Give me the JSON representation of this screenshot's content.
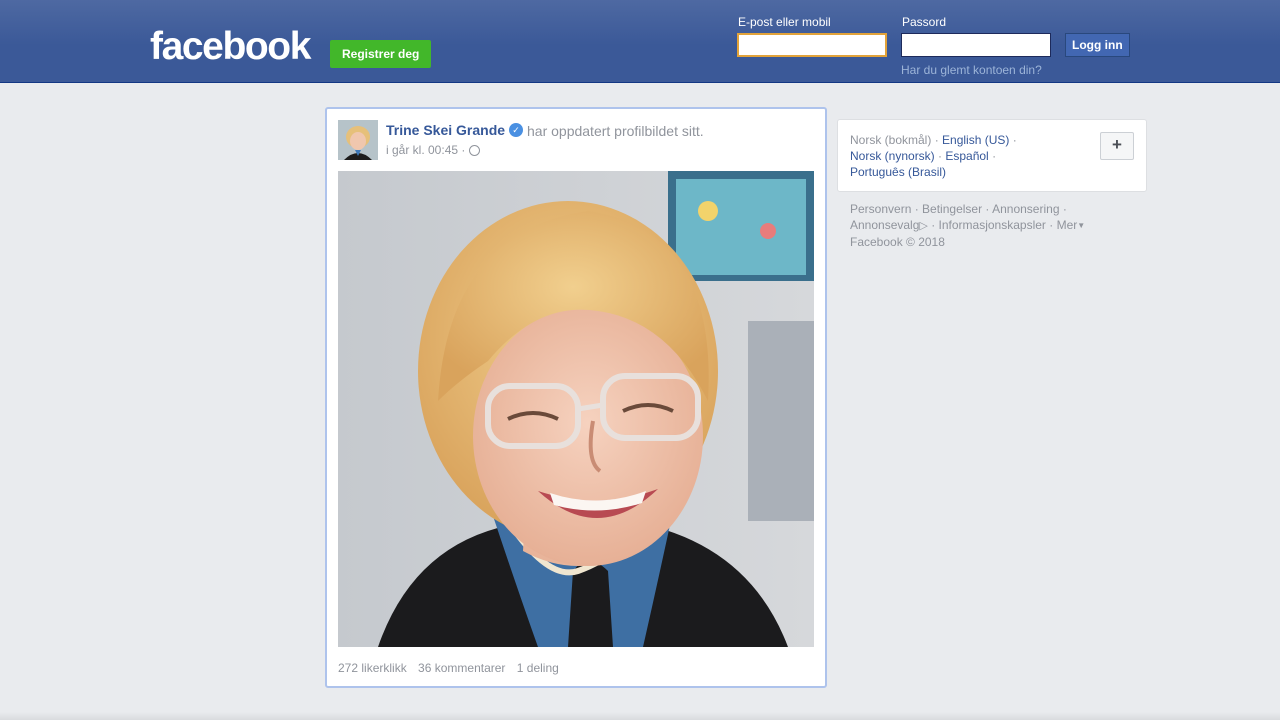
{
  "header": {
    "logo": "facebook",
    "register_label": "Registrer deg",
    "email_label": "E-post eller mobil",
    "email_value": "",
    "password_label": "Passord",
    "password_value": "",
    "login_label": "Logg inn",
    "forgot_label": "Har du glemt kontoen din?"
  },
  "post": {
    "author": "Trine Skei Grande",
    "verified_icon": "verified-badge-icon",
    "action": "har oppdatert profilbildet sitt.",
    "time": "i går kl. 00:45 ·",
    "audience_icon": "globe-icon",
    "stats": {
      "likes": "272 likerklikk",
      "comments": "36 kommentarer",
      "shares": "1 deling"
    }
  },
  "languages": {
    "current": "Norsk (bokmål)",
    "items": [
      "English (US)",
      "Norsk (nynorsk)",
      "Español",
      "Português (Brasil)"
    ],
    "more_icon": "plus-icon",
    "more_label": "+"
  },
  "footer": {
    "links": [
      "Personvern",
      "Betingelser",
      "Annonsering",
      "Annonsevalg",
      "Informasjonskapsler",
      "Mer"
    ],
    "copyright": "Facebook © 2018"
  },
  "colors": {
    "header_blue": "#3b5998",
    "link_blue": "#365899",
    "register_green": "#42b72a",
    "muted_gray": "#90949c"
  }
}
